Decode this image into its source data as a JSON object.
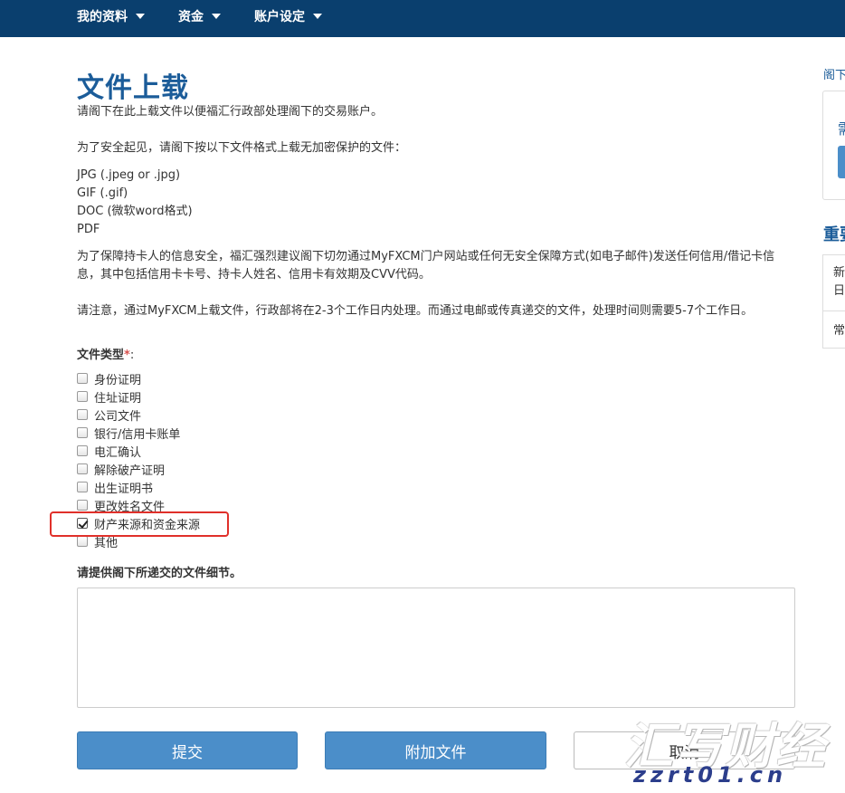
{
  "nav": {
    "items": [
      {
        "label": "我的资料"
      },
      {
        "label": "资金"
      },
      {
        "label": "账户设定"
      }
    ]
  },
  "page": {
    "title": "文件上载",
    "intro": "请阁下在此上载文件以便福汇行政部处理阁下的交易账户。",
    "security_note": "为了安全起见，请阁下按以下文件格式上载无加密保护的文件：",
    "formats": [
      "JPG (.jpeg or .jpg)",
      "GIF (.gif)",
      "DOC (微软word格式)",
      "PDF"
    ],
    "card_warning": "为了保障持卡人的信息安全，福汇强烈建议阁下切勿通过MyFXCM门户网站或任何无安全保障方式(如电子邮件)发送任何信用/借记卡信息，其中包括信用卡卡号、持卡人姓名、信用卡有效期及CVV代码。",
    "processing_note": "请注意，通过MyFXCM上载文件，行政部将在2-3个工作日内处理。而通过电邮或传真递交的文件，处理时间则需要5-7个工作日。"
  },
  "form": {
    "doc_type_label": "文件类型",
    "required_mark": "*",
    "label_colon": ":",
    "doc_types": [
      {
        "label": "身份证明",
        "checked": false
      },
      {
        "label": "住址证明",
        "checked": false
      },
      {
        "label": "公司文件",
        "checked": false
      },
      {
        "label": "银行/信用卡账单",
        "checked": false
      },
      {
        "label": "电汇确认",
        "checked": false
      },
      {
        "label": "解除破产证明",
        "checked": false
      },
      {
        "label": "出生证明书",
        "checked": false
      },
      {
        "label": "更改姓名文件",
        "checked": false
      },
      {
        "label": "财产来源和资金来源",
        "checked": true
      },
      {
        "label": "其他",
        "checked": false
      }
    ],
    "details_label": "请提供阁下所递交的文件细节。",
    "details_value": "",
    "submit_label": "提交",
    "attach_label": "附加文件",
    "cancel_label": "取消"
  },
  "sidebar": {
    "link_text": "阁下",
    "box_title": "需",
    "heading": "重要",
    "row1_line1": "新",
    "row1_line2": "日",
    "row2": "常"
  },
  "watermark": {
    "cn": "汇写财经",
    "url": "zzrt01.cn"
  },
  "colors": {
    "nav_bg": "#0a3f6e",
    "title": "#1b5c99",
    "primary_button": "#4b8ec9",
    "highlight_border": "#e0302a",
    "required": "#d9534f"
  }
}
